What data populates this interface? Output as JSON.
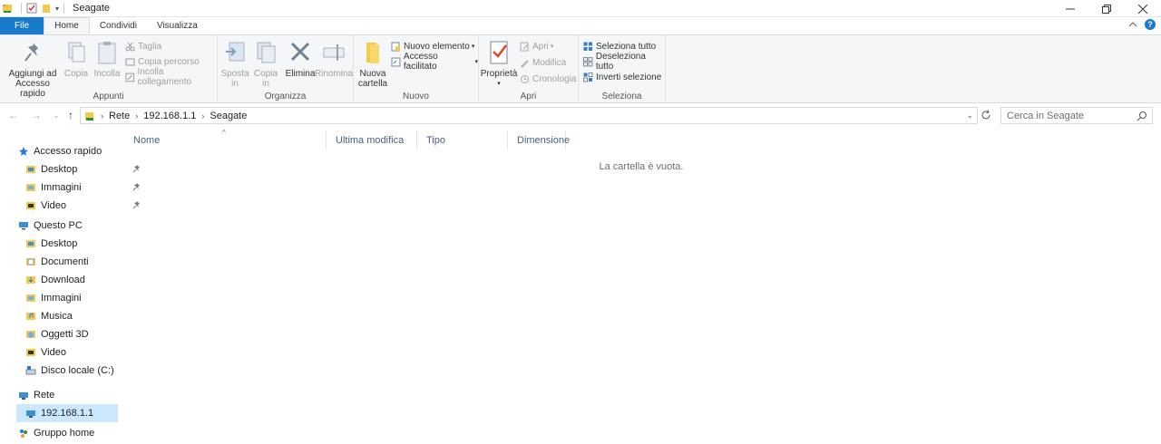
{
  "window": {
    "title": "Seagate"
  },
  "tabs": [
    {
      "label": "File"
    },
    {
      "label": "Home"
    },
    {
      "label": "Condividi"
    },
    {
      "label": "Visualizza"
    }
  ],
  "ribbon": {
    "appunti": {
      "label": "Appunti",
      "pin_quick": "Aggiungi ad\nAccesso rapido",
      "copy": "Copia",
      "paste": "Incolla",
      "cut": "Taglia",
      "copy_path": "Copia percorso",
      "paste_link": "Incolla collegamento"
    },
    "organizza": {
      "label": "Organizza",
      "move_to": "Sposta\nin",
      "copy_to": "Copia\nin",
      "delete": "Elimina",
      "rename": "Rinomina"
    },
    "nuovo": {
      "label": "Nuovo",
      "new_folder": "Nuova\ncartella",
      "new_item": "Nuovo elemento",
      "easy_access": "Accesso facilitato"
    },
    "apri": {
      "label": "Apri",
      "properties": "Proprietà",
      "open": "Apri",
      "edit": "Modifica",
      "history": "Cronologia"
    },
    "seleziona": {
      "label": "Seleziona",
      "select_all": "Seleziona tutto",
      "select_none": "Deseleziona tutto",
      "invert": "Inverti selezione"
    }
  },
  "address": {
    "crumbs": [
      "Rete",
      "192.168.1.1",
      "Seagate"
    ],
    "search_placeholder": "Cerca in Seagate"
  },
  "nav": {
    "quick_access": "Accesso rapido",
    "qa_items": [
      "Desktop",
      "Immagini",
      "Video"
    ],
    "this_pc": "Questo PC",
    "pc_items": [
      "Desktop",
      "Documenti",
      "Download",
      "Immagini",
      "Musica",
      "Oggetti 3D",
      "Video",
      "Disco locale (C:)"
    ],
    "network": "Rete",
    "network_items": [
      "192.168.1.1"
    ],
    "homegroup": "Gruppo home"
  },
  "columns": [
    "Nome",
    "Ultima modifica",
    "Tipo",
    "Dimensione"
  ],
  "empty_message": "La cartella è vuota.",
  "colors": {
    "file_tab": "#1979ca",
    "selected": "#cce8ff",
    "accent": "#1979ca"
  }
}
